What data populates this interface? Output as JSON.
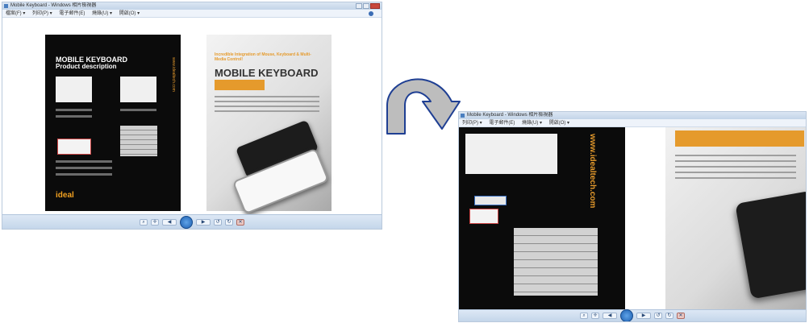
{
  "windows": [
    {
      "title": "Mobile Keyboard - Windows 相片檢視器",
      "menu": [
        "檔案(F) ▾",
        "列印(P) ▾",
        "電子郵件(E)",
        "燒錄(U) ▾",
        "開啟(O) ▾"
      ]
    },
    {
      "title": "Mobile Keyboard - Windows 相片檢視器",
      "menu": [
        "列印(P) ▾",
        "電子郵件(E)",
        "燒錄(U) ▾",
        "開啟(O) ▾"
      ]
    }
  ],
  "brochure": {
    "title": "MOBILE KEYBOARD",
    "subtitle": "Product description",
    "hero_title": "MOBILE KEYBOARD",
    "brand": "ideal",
    "url": "www.idealtech.com",
    "feature_heading": "Incredible Integration of Mouse, Keyboard & Multi-Media Control!"
  },
  "accent_colors": {
    "orange": "#e59a2c",
    "dark_page": "#0b0b0b",
    "toolbar_blue": "#c4d6ea"
  },
  "icons": [
    "zoom-icon",
    "fit-icon",
    "prev-icon",
    "slideshow-icon",
    "next-icon",
    "rotate-ccw-icon",
    "rotate-cw-icon",
    "delete-icon",
    "help-icon"
  ]
}
